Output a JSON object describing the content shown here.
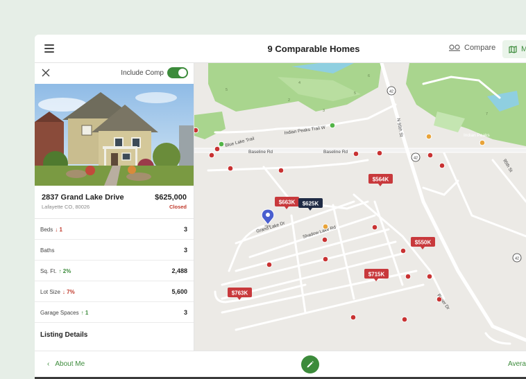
{
  "header": {
    "title": "9 Comparable Homes",
    "compare_label": "Compare",
    "map_label": "M"
  },
  "panel": {
    "include_label": "Include Comp",
    "include_on": true,
    "address": "2837 Grand Lake Drive",
    "city": "Lafayette CO, 80026",
    "price": "$625,000",
    "status": "Closed",
    "rows": [
      {
        "label": "Beds",
        "delta": "↓ 1",
        "dir": "down",
        "value": "3"
      },
      {
        "label": "Baths",
        "delta": "",
        "dir": "",
        "value": "3"
      },
      {
        "label": "Sq. Ft.",
        "delta": "↑ 2%",
        "dir": "up",
        "value": "2,488"
      },
      {
        "label": "Lot Size",
        "delta": "↓ 7%",
        "dir": "down",
        "value": "5,600"
      },
      {
        "label": "Garage Spaces",
        "delta": "↑ 1",
        "dir": "up",
        "value": "3"
      }
    ],
    "listing_details": "Listing Details"
  },
  "map": {
    "streets": {
      "indian_peaks_trail_w": "Indian Peaks Trail W",
      "blue_lake_trail": "Blue Lake Trail",
      "baseline_rd_left": "Baseline Rd",
      "baseline_rd_right": "Baseline Rd",
      "n_95th_st": "N 95th St",
      "grand_lake_dr": "Grand Lake Dr",
      "shadow_lake_rd": "Shadow Lake Rd",
      "roser_dr": "Roser Dr",
      "st_95th": "95th St",
      "indian_peaks": "Indian Peaks"
    },
    "route_badges": [
      "42",
      "42",
      "42"
    ],
    "price_tags": [
      "$564K",
      "$663K",
      "$625K",
      "$550K",
      "$715K",
      "$763K"
    ],
    "hole_numbers": [
      "5",
      "4",
      "3",
      "2",
      "6",
      "7",
      "5"
    ]
  },
  "footer": {
    "back_label": "About Me",
    "right_label": "Avera"
  },
  "colors": {
    "accent": "#3c8b3b",
    "price_tag": "#c8393c",
    "price_tag_selected": "#1f2b45",
    "dot_red": "#c83232",
    "dot_green": "#52b447",
    "dot_orange": "#e8a43a",
    "pin": "#4a5fcf"
  }
}
